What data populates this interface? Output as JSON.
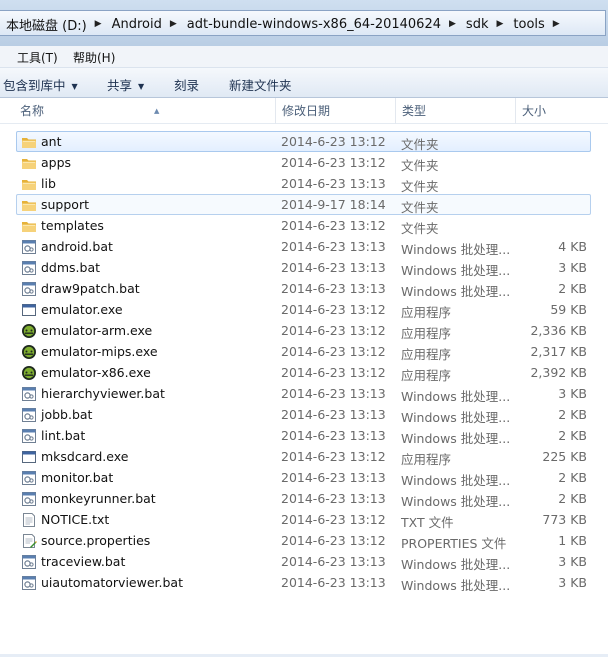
{
  "address": {
    "crumbs": [
      "本地磁盘 (D:)",
      "Android",
      "adt-bundle-windows-x86_64-20140624",
      "sdk",
      "tools"
    ]
  },
  "menu": {
    "tools": "工具(T)",
    "help": "帮助(H)"
  },
  "toolbar": {
    "include_library": "包含到库中",
    "share": "共享",
    "burn": "刻录",
    "new_folder": "新建文件夹"
  },
  "columns": {
    "name": "名称",
    "date": "修改日期",
    "type": "类型",
    "size": "大小"
  },
  "files": [
    {
      "name": "ant",
      "date": "2014-6-23 13:12",
      "type": "文件夹",
      "size": "",
      "icon": "folder-icon",
      "state": "selected"
    },
    {
      "name": "apps",
      "date": "2014-6-23 13:12",
      "type": "文件夹",
      "size": "",
      "icon": "folder-icon",
      "state": ""
    },
    {
      "name": "lib",
      "date": "2014-6-23 13:13",
      "type": "文件夹",
      "size": "",
      "icon": "folder-icon",
      "state": ""
    },
    {
      "name": "support",
      "date": "2014-9-17 18:14",
      "type": "文件夹",
      "size": "",
      "icon": "folder-icon",
      "state": "hover"
    },
    {
      "name": "templates",
      "date": "2014-6-23 13:12",
      "type": "文件夹",
      "size": "",
      "icon": "folder-icon",
      "state": ""
    },
    {
      "name": "android.bat",
      "date": "2014-6-23 13:13",
      "type": "Windows 批处理...",
      "size": "4 KB",
      "icon": "batch-file-icon",
      "state": ""
    },
    {
      "name": "ddms.bat",
      "date": "2014-6-23 13:13",
      "type": "Windows 批处理...",
      "size": "3 KB",
      "icon": "batch-file-icon",
      "state": ""
    },
    {
      "name": "draw9patch.bat",
      "date": "2014-6-23 13:13",
      "type": "Windows 批处理...",
      "size": "2 KB",
      "icon": "batch-file-icon",
      "state": ""
    },
    {
      "name": "emulator.exe",
      "date": "2014-6-23 13:12",
      "type": "应用程序",
      "size": "59 KB",
      "icon": "exe-window-icon",
      "state": ""
    },
    {
      "name": "emulator-arm.exe",
      "date": "2014-6-23 13:12",
      "type": "应用程序",
      "size": "2,336 KB",
      "icon": "emulator-app-icon",
      "state": ""
    },
    {
      "name": "emulator-mips.exe",
      "date": "2014-6-23 13:12",
      "type": "应用程序",
      "size": "2,317 KB",
      "icon": "emulator-app-icon",
      "state": ""
    },
    {
      "name": "emulator-x86.exe",
      "date": "2014-6-23 13:12",
      "type": "应用程序",
      "size": "2,392 KB",
      "icon": "emulator-app-icon",
      "state": ""
    },
    {
      "name": "hierarchyviewer.bat",
      "date": "2014-6-23 13:13",
      "type": "Windows 批处理...",
      "size": "3 KB",
      "icon": "batch-file-icon",
      "state": ""
    },
    {
      "name": "jobb.bat",
      "date": "2014-6-23 13:13",
      "type": "Windows 批处理...",
      "size": "2 KB",
      "icon": "batch-file-icon",
      "state": ""
    },
    {
      "name": "lint.bat",
      "date": "2014-6-23 13:13",
      "type": "Windows 批处理...",
      "size": "2 KB",
      "icon": "batch-file-icon",
      "state": ""
    },
    {
      "name": "mksdcard.exe",
      "date": "2014-6-23 13:12",
      "type": "应用程序",
      "size": "225 KB",
      "icon": "exe-window-icon",
      "state": ""
    },
    {
      "name": "monitor.bat",
      "date": "2014-6-23 13:13",
      "type": "Windows 批处理...",
      "size": "2 KB",
      "icon": "batch-file-icon",
      "state": ""
    },
    {
      "name": "monkeyrunner.bat",
      "date": "2014-6-23 13:13",
      "type": "Windows 批处理...",
      "size": "2 KB",
      "icon": "batch-file-icon",
      "state": ""
    },
    {
      "name": "NOTICE.txt",
      "date": "2014-6-23 13:12",
      "type": "TXT 文件",
      "size": "773 KB",
      "icon": "text-file-icon",
      "state": ""
    },
    {
      "name": "source.properties",
      "date": "2014-6-23 13:12",
      "type": "PROPERTIES 文件",
      "size": "1 KB",
      "icon": "properties-file-icon",
      "state": ""
    },
    {
      "name": "traceview.bat",
      "date": "2014-6-23 13:13",
      "type": "Windows 批处理...",
      "size": "3 KB",
      "icon": "batch-file-icon",
      "state": ""
    },
    {
      "name": "uiautomatorviewer.bat",
      "date": "2014-6-23 13:13",
      "type": "Windows 批处理...",
      "size": "3 KB",
      "icon": "batch-file-icon",
      "state": ""
    }
  ],
  "colors": {
    "selection_fill": "#e3efff",
    "selection_border": "#a9c9ee",
    "folder": "#e8b93c",
    "header_text": "#4c607a"
  }
}
